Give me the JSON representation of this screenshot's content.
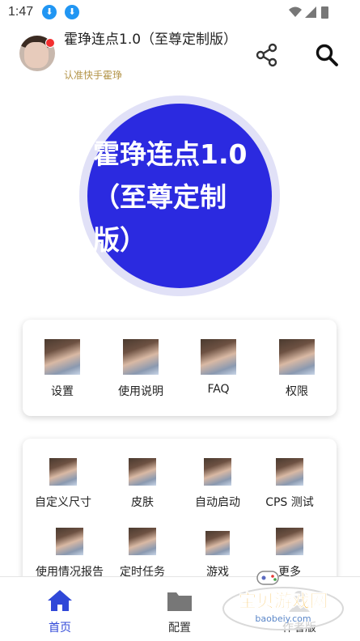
{
  "status": {
    "time": "1:47"
  },
  "header": {
    "title": "霍琤连点1.0（至尊定制版）",
    "subtitle": "认准快手霍琤"
  },
  "hero": {
    "text": "霍琤连点1.0（至尊定制版）"
  },
  "quick_menu": [
    {
      "label": "设置"
    },
    {
      "label": "使用说明"
    },
    {
      "label": "FAQ"
    },
    {
      "label": "权限"
    }
  ],
  "features": [
    {
      "label": "自定义尺寸"
    },
    {
      "label": "皮肤"
    },
    {
      "label": "自动启动"
    },
    {
      "label": "CPS 测试"
    },
    {
      "label": "使用情况报告"
    },
    {
      "label": "定时任务"
    },
    {
      "label": "游戏"
    },
    {
      "label": "更多"
    }
  ],
  "bottom_nav": [
    {
      "label": "首页",
      "active": true
    },
    {
      "label": "配置",
      "active": false
    },
    {
      "label": "作者版",
      "active": false
    }
  ],
  "watermark": {
    "text": "宝贝游戏网",
    "url_text": "baobeiy.com"
  },
  "colors": {
    "accent": "#2b2ae0",
    "nav_active": "#3048d8",
    "subtitle": "#b39448"
  }
}
